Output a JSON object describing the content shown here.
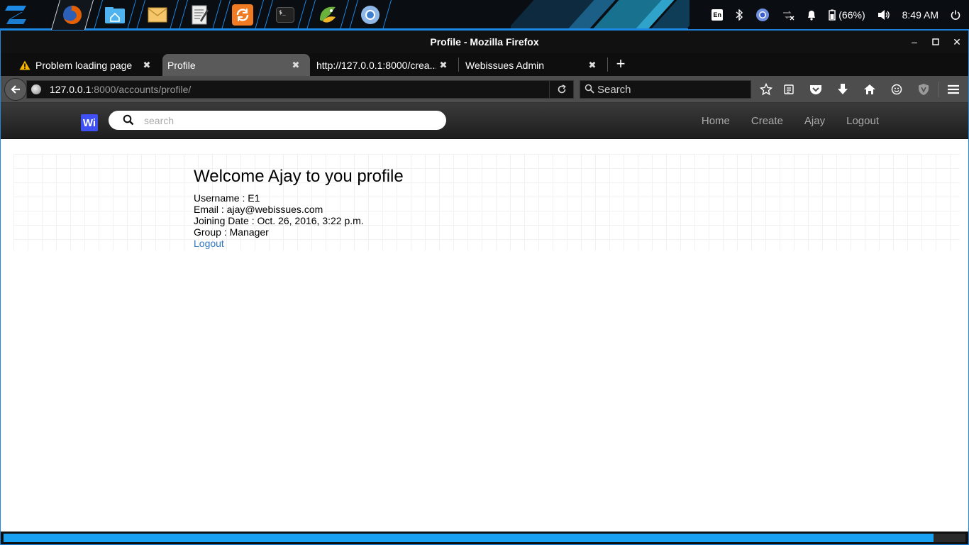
{
  "taskbar": {
    "apps": [
      {
        "name": "firefox",
        "color": "#e66000"
      },
      {
        "name": "file-manager",
        "color": "#4fb3f0"
      },
      {
        "name": "mail",
        "color": "#f5c66a"
      },
      {
        "name": "text-editor",
        "color": "#d9d9d9"
      },
      {
        "name": "software-updater",
        "color": "#f07b23"
      },
      {
        "name": "terminal",
        "color": "#222222"
      },
      {
        "name": "pycharm",
        "color": "#6ab23b"
      },
      {
        "name": "chromium",
        "color": "#6fa8dc"
      }
    ],
    "tray": {
      "keyboard_layout": "En",
      "battery": "(66%)",
      "clock": "8:49 AM"
    }
  },
  "window": {
    "title": "Profile - Mozilla Firefox"
  },
  "tabs": [
    {
      "label": "Problem loading page",
      "warning": true
    },
    {
      "label": "Profile",
      "active": true
    },
    {
      "label": "http://127.0.0.1:8000/crea..."
    },
    {
      "label": "Webissues Admin"
    }
  ],
  "urlbar": {
    "host": "127.0.0.1",
    "path": ":8000/accounts/profile/"
  },
  "searchbar": {
    "placeholder": "Search"
  },
  "site": {
    "logo": "Wi",
    "search_placeholder": "search",
    "nav": [
      "Home",
      "Create",
      "Ajay",
      "Logout"
    ]
  },
  "profile": {
    "heading": "Welcome Ajay to you profile",
    "username": "Username : E1",
    "email": "Email : ajay@webissues.com",
    "joining_date": "Joining Date : Oct. 26, 2016, 3:22 p.m.",
    "group": "Group : Manager",
    "logout": "Logout"
  },
  "status": {
    "progress": 0.967,
    "accent": "#1aa0f0"
  }
}
